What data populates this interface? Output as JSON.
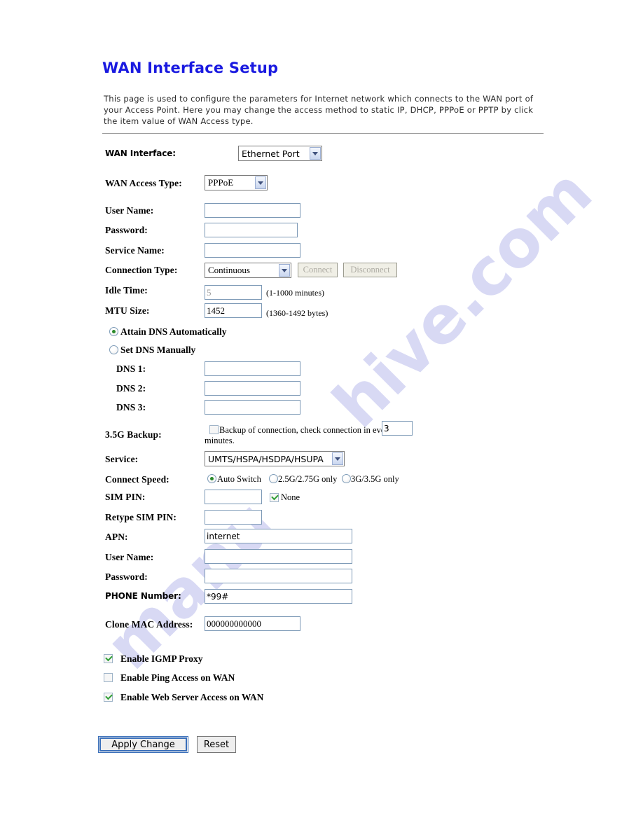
{
  "page": {
    "title": "WAN Interface Setup",
    "description": "This page is used to configure the parameters for Internet network which connects to the WAN port of your Access Point. Here you may change the access method to static IP, DHCP, PPPoE or PPTP by click the item value of WAN Access type.",
    "title_color": "#1a1ae0"
  },
  "watermark": {
    "line1": "hive.com",
    "line2": "manu"
  },
  "form": {
    "wan_interface": {
      "label": "WAN Interface:",
      "value": "Ethernet Port"
    },
    "wan_access_type": {
      "label": "WAN Access Type:",
      "value": "PPPoE"
    },
    "user_name": {
      "label": "User Name:",
      "value": ""
    },
    "password": {
      "label": "Password:",
      "value": ""
    },
    "service_name": {
      "label": "Service Name:",
      "value": ""
    },
    "connection_type": {
      "label": "Connection Type:",
      "value": "Continuous"
    },
    "connect_button": {
      "label": "Connect"
    },
    "disconnect_button": {
      "label": "Disconnect"
    },
    "idle_time": {
      "label": "Idle Time:",
      "value": "5",
      "hint": "(1-1000 minutes)"
    },
    "mtu_size": {
      "label": "MTU Size:",
      "value": "1452",
      "hint": "(1360-1492 bytes)"
    },
    "dns_mode": {
      "attain_auto_label": "Attain DNS Automatically",
      "set_manual_label": "Set DNS Manually",
      "selected": "attain_auto"
    },
    "dns1": {
      "label": "DNS 1:",
      "value": ""
    },
    "dns2": {
      "label": "DNS 2:",
      "value": ""
    },
    "dns3": {
      "label": "DNS 3:",
      "value": ""
    },
    "backup_35g": {
      "label": "3.5G Backup:",
      "checkbox_text": "Backup of connection, check connection in every",
      "checked": false,
      "interval_value": "3",
      "trailing_text": "minutes."
    },
    "service": {
      "label": "Service:",
      "value": "UMTS/HSPA/HSDPA/HSUPA"
    },
    "connect_speed": {
      "label": "Connect Speed:",
      "options": [
        "Auto Switch",
        "2.5G/2.75G only",
        "3G/3.5G only"
      ],
      "selected_index": 0
    },
    "sim_pin": {
      "label": "SIM PIN:",
      "value": "",
      "none_label": "None",
      "none_checked": true
    },
    "retype_sim_pin": {
      "label": "Retype SIM PIN:",
      "value": ""
    },
    "apn": {
      "label": "APN:",
      "value": "internet"
    },
    "mobile_user_name": {
      "label": "User Name:",
      "value": ""
    },
    "mobile_password": {
      "label": "Password:",
      "value": ""
    },
    "phone_number": {
      "label": "PHONE Number:",
      "value": "*99#"
    },
    "clone_mac": {
      "label": "Clone MAC Address:",
      "value": "000000000000"
    }
  },
  "toggles": [
    {
      "label": "Enable IGMP Proxy",
      "checked": true
    },
    {
      "label": "Enable Ping Access on WAN",
      "checked": false
    },
    {
      "label": "Enable Web Server Access on WAN",
      "checked": true
    }
  ],
  "actions": {
    "apply_label": "Apply Change",
    "reset_label": "Reset"
  }
}
